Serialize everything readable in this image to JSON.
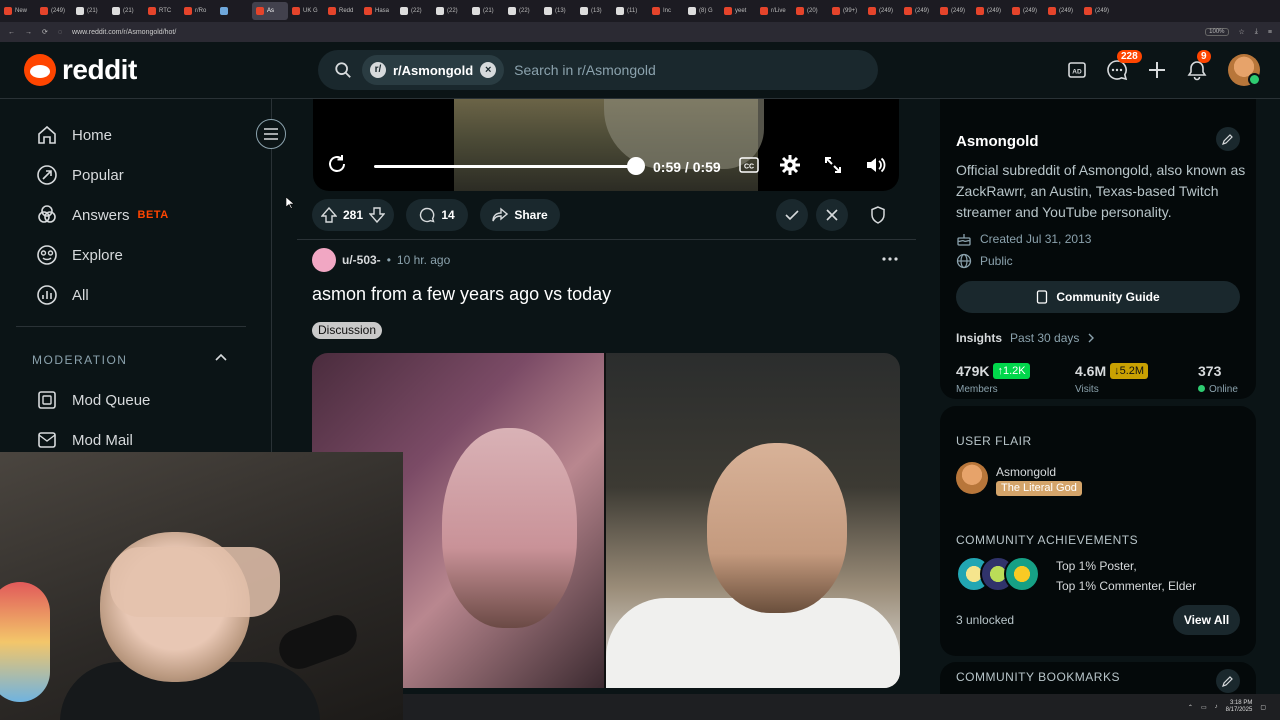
{
  "browser": {
    "tabs": [
      "New",
      "(249)",
      "(21)",
      "(21)",
      "RTC",
      "r/Ro",
      "",
      "As",
      "UK G",
      "Redd",
      "Hasa",
      "(22)",
      "(22)",
      "(21)",
      "(22)",
      "(13)",
      "(13)",
      "(11)",
      "Inc",
      "(8) G",
      "yeet",
      "r/Live",
      "(20)",
      "(99+)",
      "(249)",
      "(249)",
      "(249)",
      "(249)",
      "(249)",
      "(249)",
      "(249)"
    ],
    "url": "www.reddit.com/r/Asmongold/hot/",
    "zoom": "100%"
  },
  "header": {
    "logo_text": "reddit",
    "search_chip": "r/Asmongold",
    "search_placeholder": "Search in r/Asmongold",
    "chat_badge": "228",
    "notif_badge": "9"
  },
  "nav": {
    "items": [
      {
        "label": "Home",
        "icon": "home-icon"
      },
      {
        "label": "Popular",
        "icon": "popular-icon"
      },
      {
        "label": "Answers",
        "icon": "answers-icon",
        "tag": "BETA"
      },
      {
        "label": "Explore",
        "icon": "explore-icon"
      },
      {
        "label": "All",
        "icon": "all-icon"
      }
    ],
    "moderation_heading": "MODERATION",
    "mod_items": [
      {
        "label": "Mod Queue",
        "icon": "mod-queue-icon"
      },
      {
        "label": "Mod Mail",
        "icon": "mod-mail-icon"
      }
    ]
  },
  "video": {
    "time": "0:59 / 0:59",
    "progress": 1.0
  },
  "post_actions": {
    "upvotes": "281",
    "comments": "14",
    "share_label": "Share"
  },
  "post": {
    "author": "u/-503-",
    "separator": "•",
    "time": "10 hr. ago",
    "title": "asmon from a few years ago vs today",
    "flair": "Discussion"
  },
  "sidebar": {
    "name": "Asmongold",
    "description": "Official subreddit of Asmongold, also known as ZackRawrr, an Austin, Texas-based Twitch streamer and YouTube personality.",
    "created": "Created Jul 31, 2013",
    "visibility": "Public",
    "guide_label": "Community Guide",
    "insights_label": "Insights",
    "insights_range": "Past 30 days",
    "members": {
      "value": "479K",
      "delta": "1.2K",
      "label": "Members"
    },
    "visits": {
      "value": "4.6M",
      "delta": "5.2M",
      "label": "Visits"
    },
    "online": {
      "value": "373",
      "label": "Online"
    },
    "user_flair_heading": "USER FLAIR",
    "flair_user": "Asmongold",
    "flair_tag": "The Literal God",
    "achievements_heading": "COMMUNITY ACHIEVEMENTS",
    "achievements_line1": "Top 1% Poster,",
    "achievements_line2": "Top 1% Commenter, Elder",
    "unlocked": "3 unlocked",
    "view_all": "View All",
    "bookmarks_heading": "COMMUNITY BOOKMARKS"
  },
  "taskbar": {
    "time": "3:18 PM",
    "date": "8/17/2025"
  },
  "colors": {
    "brand": "#ff4500",
    "background": "#0b1416",
    "up_delta": "#01d74b",
    "down_delta": "#c9a102"
  }
}
